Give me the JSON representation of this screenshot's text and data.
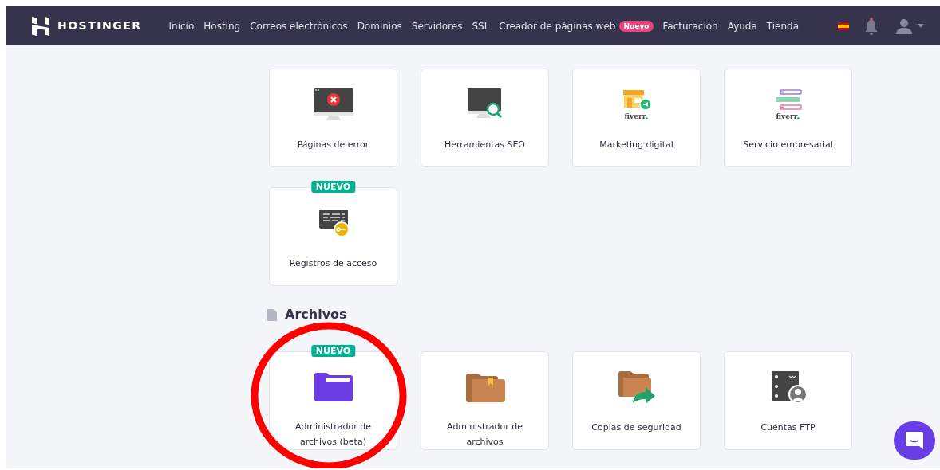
{
  "navbar": {
    "logo": "HOSTINGER",
    "items": [
      {
        "label": "Inicio"
      },
      {
        "label": "Hosting"
      },
      {
        "label": "Correos electrónicos"
      },
      {
        "label": "Dominios"
      },
      {
        "label": "Servidores"
      },
      {
        "label": "SSL"
      },
      {
        "label": "Creador de páginas web",
        "badge": "Nuevo"
      },
      {
        "label": "Facturación"
      },
      {
        "label": "Ayuda"
      },
      {
        "label": "Tienda"
      }
    ]
  },
  "sections": [
    {
      "cards": [
        {
          "label": "Páginas de error",
          "kind": "error-monitor"
        },
        {
          "label": "Herramientas SEO",
          "kind": "seo-monitor"
        },
        {
          "label": "Marketing digital",
          "kind": "fiverr-shop",
          "logo_text": "fiverr"
        },
        {
          "label": "Servicio empresarial",
          "kind": "fiverr-list",
          "logo_text": "fiverr"
        },
        {
          "label": "Registros de acceso",
          "kind": "access-log",
          "badge": "NUEVO"
        }
      ]
    },
    {
      "heading": "Archivos",
      "cards": [
        {
          "label": "Administrador de archivos (beta)",
          "kind": "folder-purple",
          "badge": "NUEVO"
        },
        {
          "label": "Administrador de archivos",
          "kind": "folder-brown"
        },
        {
          "label": "Copias de seguridad",
          "kind": "folder-share"
        },
        {
          "label": "Cuentas FTP",
          "kind": "ftp-server"
        }
      ]
    }
  ]
}
